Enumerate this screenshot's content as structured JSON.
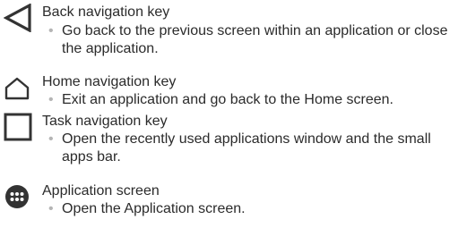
{
  "items": [
    {
      "icon": "back-triangle-icon",
      "title": "Back navigation key",
      "bullet": "•",
      "description": "Go back to the previous screen within an application or close the application."
    },
    {
      "icon": "home-icon",
      "title": "Home navigation key",
      "bullet": "•",
      "description": "Exit an application and go back to the Home screen."
    },
    {
      "icon": "task-square-icon",
      "title": "Task navigation key",
      "bullet": "•",
      "description": "Open the recently used applications window and the small apps bar."
    },
    {
      "icon": "app-grid-icon",
      "title": "Application screen",
      "bullet": "•",
      "description": "Open the Application screen."
    }
  ],
  "colors": {
    "icon": "#333333",
    "bullet": "#b5b5b5",
    "text": "#2b2b2b"
  }
}
